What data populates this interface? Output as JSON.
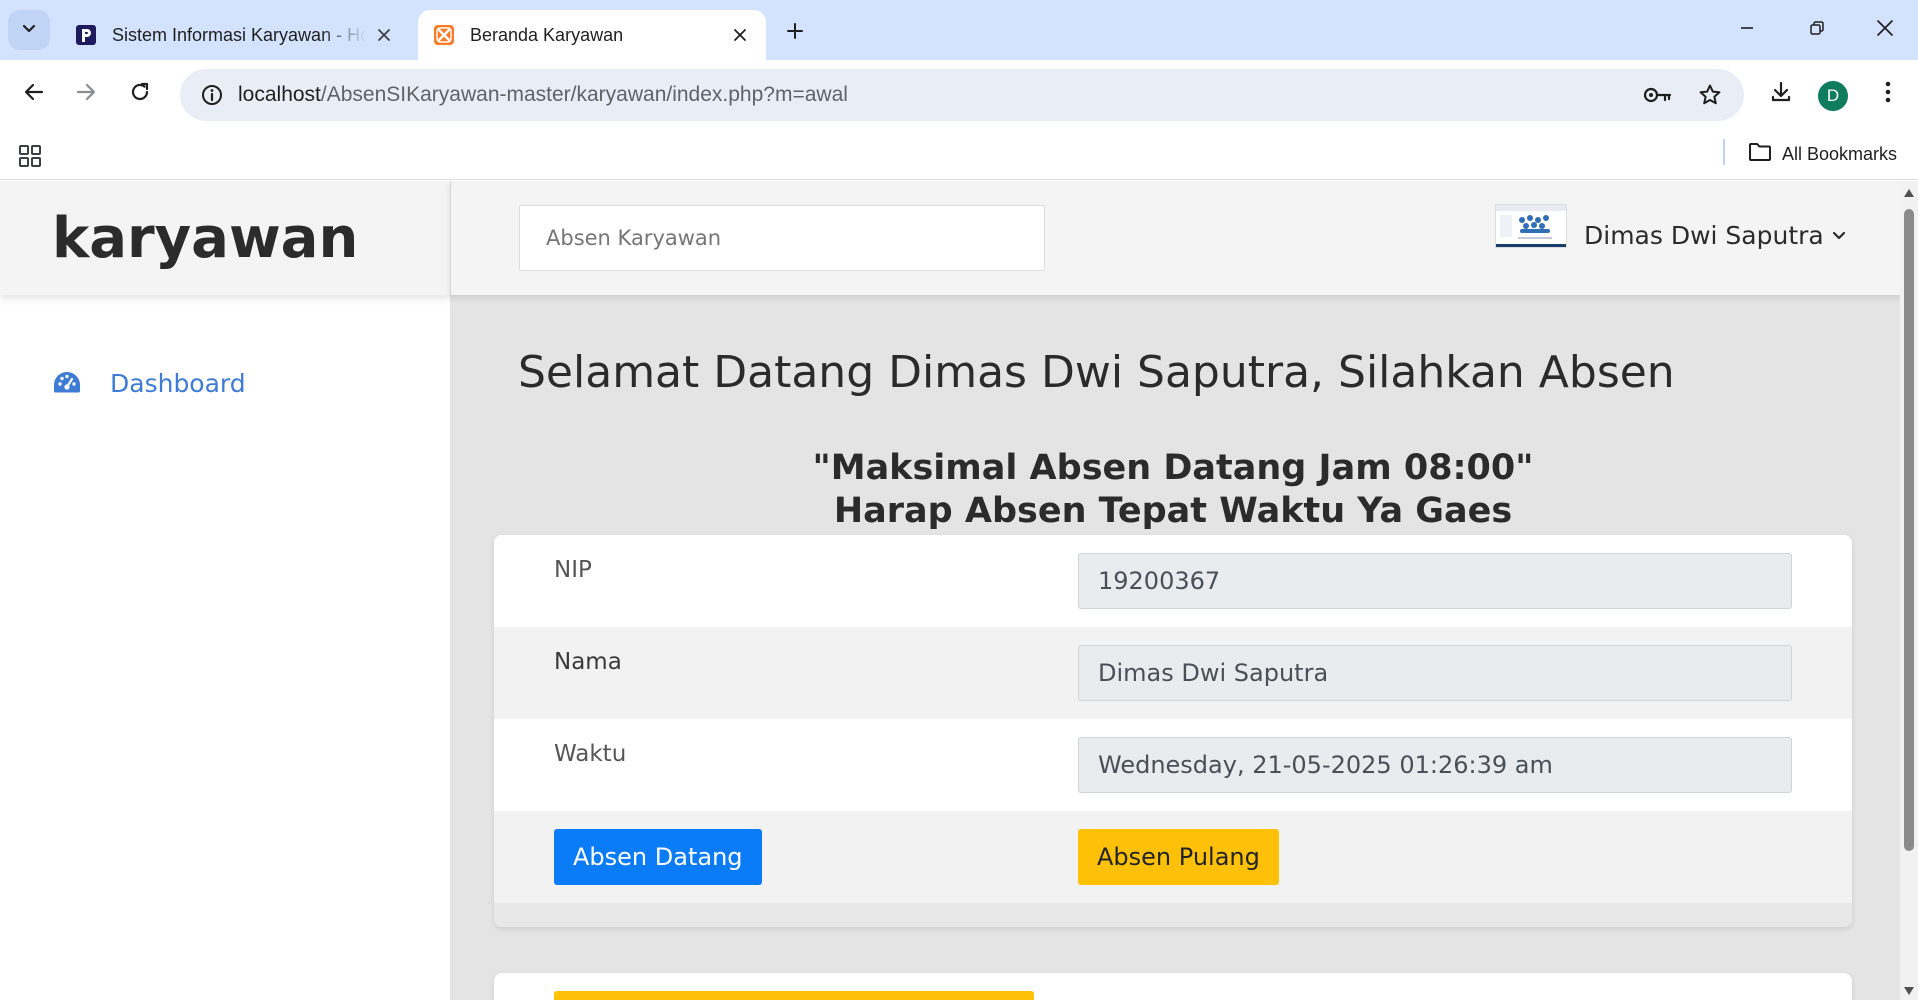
{
  "browser": {
    "tabs": [
      {
        "title": "Sistem Informasi Karyawan - Ho",
        "favicon": "p-logo-icon",
        "active": false
      },
      {
        "title": "Beranda Karyawan",
        "favicon": "xampp-icon",
        "active": true
      }
    ],
    "url_host": "localhost",
    "url_path": "/AbsenSIKaryawan-master/karyawan/index.php?m=awal",
    "profile_initial": "D",
    "all_bookmarks_label": "All Bookmarks"
  },
  "sidebar": {
    "brand": "karyawan",
    "items": [
      {
        "label": "Dashboard",
        "icon": "dashboard-gauge-icon"
      }
    ]
  },
  "topnav": {
    "search_placeholder": "Absen Karyawan",
    "user_name": "Dimas Dwi Saputra"
  },
  "main": {
    "welcome": "Selamat Datang Dimas Dwi Saputra, Silahkan Absen",
    "notice_line1": "\"Maksimal Absen Datang Jam 08:00\"",
    "notice_line2": "Harap Absen Tepat Waktu Ya Gaes",
    "form": {
      "nip_label": "NIP",
      "nip_value": "19200367",
      "nama_label": "Nama",
      "nama_value": "Dimas Dwi Saputra",
      "waktu_label": "Waktu",
      "waktu_value": "Wednesday, 21-05-2025 01:26:39 am",
      "btn_datang": "Absen Datang",
      "btn_pulang": "Absen Pulang"
    }
  },
  "colors": {
    "accent_blue": "#0a7cf7",
    "accent_yellow": "#ffc107",
    "sidebar_link": "#3d7bd4",
    "tabbar": "#d3e3fd"
  }
}
